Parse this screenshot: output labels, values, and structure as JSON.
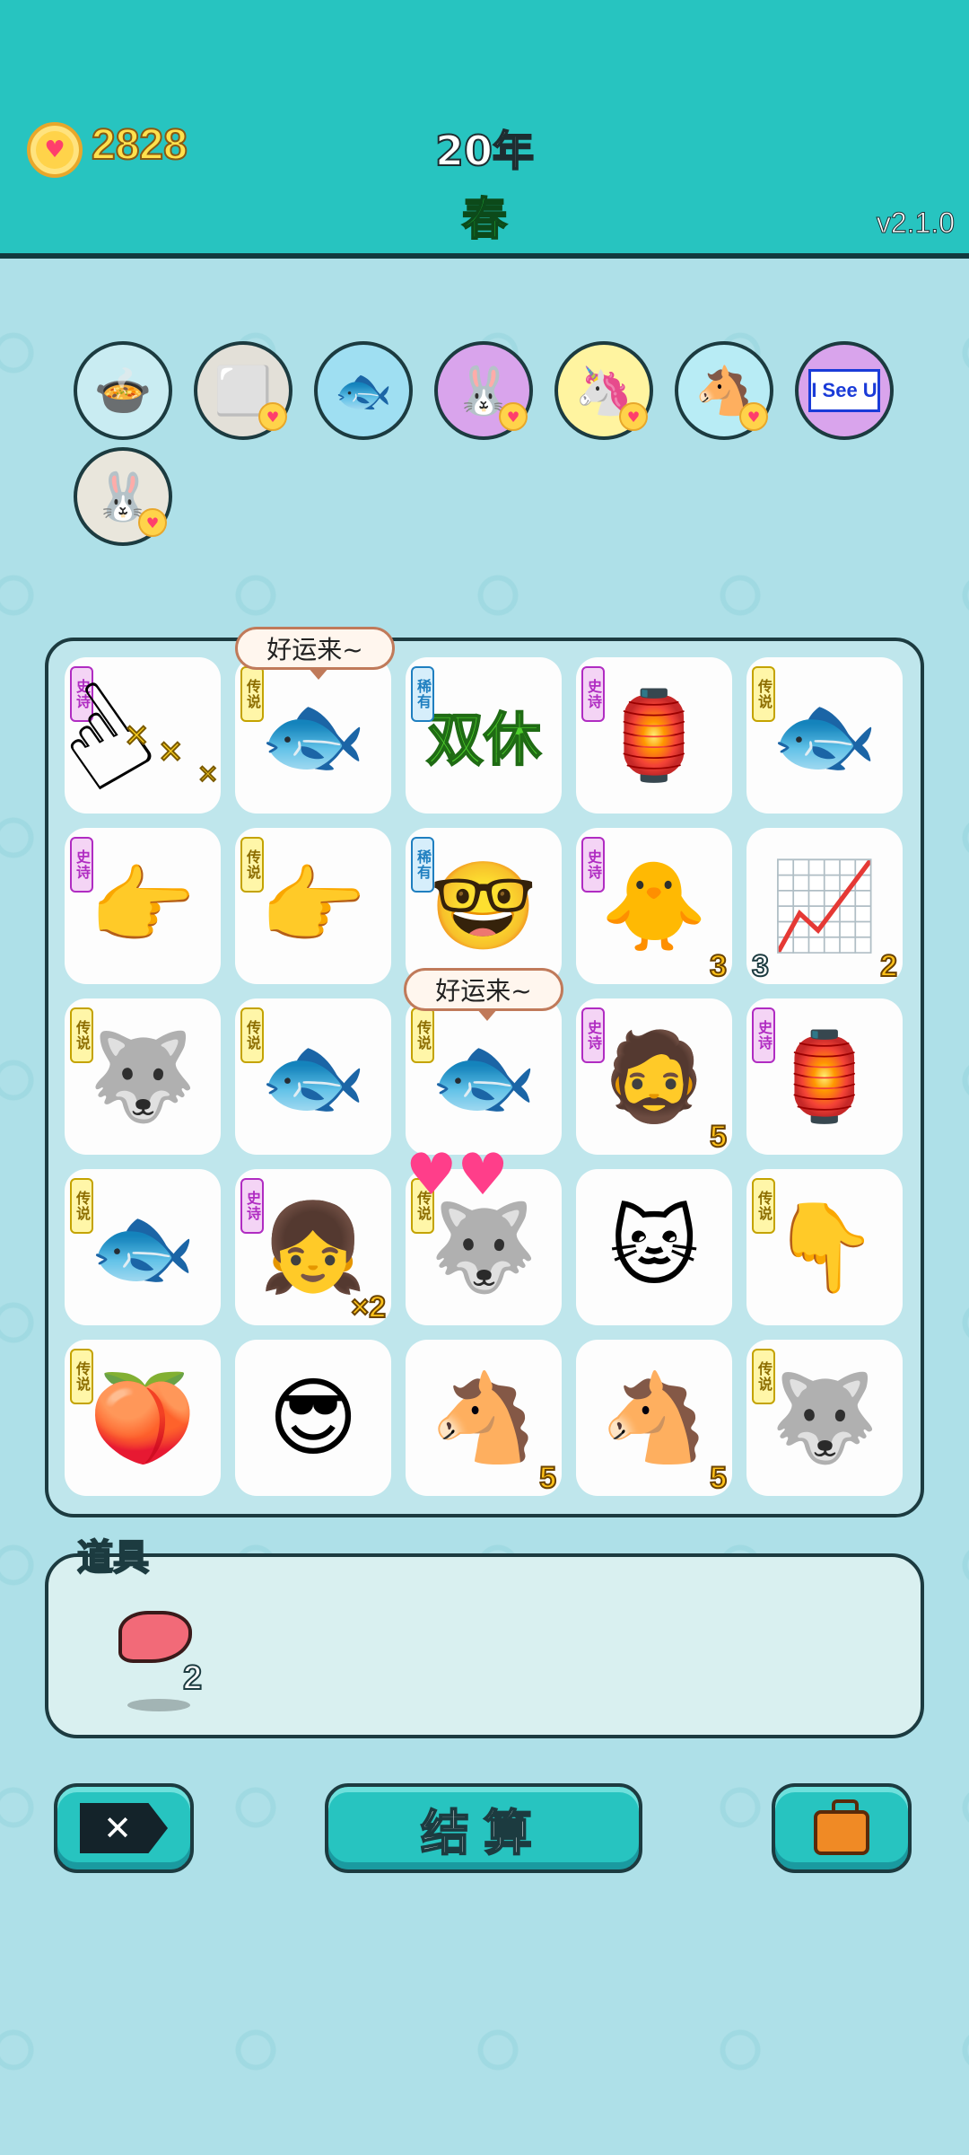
{
  "header": {
    "coins": "2828",
    "year": "20年",
    "season": "春",
    "version": "v2.1.0",
    "colors": {
      "header_bg": "#27c4c0",
      "coin_text": "#ffe14d",
      "season_text": "#25c93d"
    }
  },
  "collected": [
    {
      "icon": "pot-with-duck-icon",
      "glyph": "🍲",
      "bg": "#c9ecf2",
      "badge": false
    },
    {
      "icon": "sugar-cubes-icon",
      "glyph": "⬜",
      "bg": "#e3e0d8",
      "badge": true
    },
    {
      "icon": "fish-bowl-icon",
      "glyph": "🐟",
      "bg": "#9fdff2",
      "badge": false
    },
    {
      "icon": "bunny-icon",
      "glyph": "🐰",
      "bg": "#d9a4ec",
      "badge": true
    },
    {
      "icon": "unicorn-icon",
      "glyph": "🦄",
      "bg": "#fff4a0",
      "badge": true
    },
    {
      "icon": "two-horses-icon",
      "glyph": "🐴",
      "bg": "#b8ecf5",
      "badge": true
    },
    {
      "icon": "i-see-u-icon",
      "glyph": "",
      "text": "I See U",
      "bg": "#d9a4ec",
      "badge": false
    },
    {
      "icon": "bunny-icon",
      "glyph": "🐰",
      "bg": "#e9e6dc",
      "badge": true
    }
  ],
  "board": {
    "speech": [
      "好运来~",
      "好运来~"
    ],
    "cells": [
      {
        "icon": "pointing-hand-icon",
        "glyph": "",
        "tag": "史诗",
        "tag_type": "epic"
      },
      {
        "icon": "koi-fish-icon",
        "glyph": "🐟",
        "tag": "传说",
        "tag_type": "legend"
      },
      {
        "icon": "double-rest-icon",
        "glyph": "",
        "text": "双休",
        "tag": "稀有",
        "tag_type": "rare"
      },
      {
        "icon": "lantern-tent-icon",
        "glyph": "🏮",
        "tag": "史诗",
        "tag_type": "epic"
      },
      {
        "icon": "koi-fish-icon",
        "glyph": "🐟",
        "tag": "传说",
        "tag_type": "legend"
      },
      {
        "icon": "gray-hand-icon",
        "glyph": "👉",
        "tag": "史诗",
        "tag_type": "epic"
      },
      {
        "icon": "golden-hand-icon",
        "glyph": "👉",
        "tag": "传说",
        "tag_type": "legend"
      },
      {
        "icon": "glasses-man-icon",
        "glyph": "🤓",
        "tag": "稀有",
        "tag_type": "rare"
      },
      {
        "icon": "yellow-chick-icon",
        "glyph": "🐥",
        "tag": "史诗",
        "tag_type": "epic",
        "count": "3"
      },
      {
        "icon": "trend-chart-icon",
        "glyph": "📈",
        "tag": "",
        "tag_type": "",
        "count": "2",
        "count_left": "3"
      },
      {
        "icon": "husky-king-icon",
        "glyph": "🐺",
        "tag": "传说",
        "tag_type": "legend"
      },
      {
        "icon": "koi-fish-icon",
        "glyph": "🐟",
        "tag": "传说",
        "tag_type": "legend"
      },
      {
        "icon": "koi-fish-icon",
        "glyph": "🐟",
        "tag": "传说",
        "tag_type": "legend"
      },
      {
        "icon": "green-hat-man-icon",
        "glyph": "🧔",
        "tag": "史诗",
        "tag_type": "epic",
        "count": "5"
      },
      {
        "icon": "lantern-tent-icon",
        "glyph": "🏮",
        "tag": "史诗",
        "tag_type": "epic"
      },
      {
        "icon": "koi-fish-icon",
        "glyph": "🐟",
        "tag": "传说",
        "tag_type": "legend"
      },
      {
        "icon": "braided-girl-icon",
        "glyph": "👧",
        "tag": "史诗",
        "tag_type": "epic",
        "count": "×2"
      },
      {
        "icon": "husky-king-icon",
        "glyph": "🐺",
        "tag": "传说",
        "tag_type": "legend"
      },
      {
        "icon": "orange-cat-icon",
        "glyph": "🐱",
        "tag": "",
        "tag_type": ""
      },
      {
        "icon": "golden-hand-icon",
        "glyph": "👇",
        "tag": "传说",
        "tag_type": "legend"
      },
      {
        "icon": "plums-icon",
        "glyph": "🍑",
        "tag": "传说",
        "tag_type": "legend"
      },
      {
        "icon": "heart-glasses-man-icon",
        "glyph": "😎",
        "tag": "",
        "tag_type": ""
      },
      {
        "icon": "horse-icon",
        "glyph": "🐴",
        "tag": "",
        "tag_type": "",
        "count": "5"
      },
      {
        "icon": "horse-icon",
        "glyph": "🐴",
        "tag": "",
        "tag_type": "",
        "count": "5"
      },
      {
        "icon": "husky-king-icon",
        "glyph": "🐺",
        "tag": "传说",
        "tag_type": "legend"
      }
    ]
  },
  "props": {
    "label": "道具",
    "items": [
      {
        "icon": "liver-icon",
        "count": "2"
      }
    ]
  },
  "buttons": {
    "close_glyph": "✕",
    "settle_label": "结算"
  }
}
